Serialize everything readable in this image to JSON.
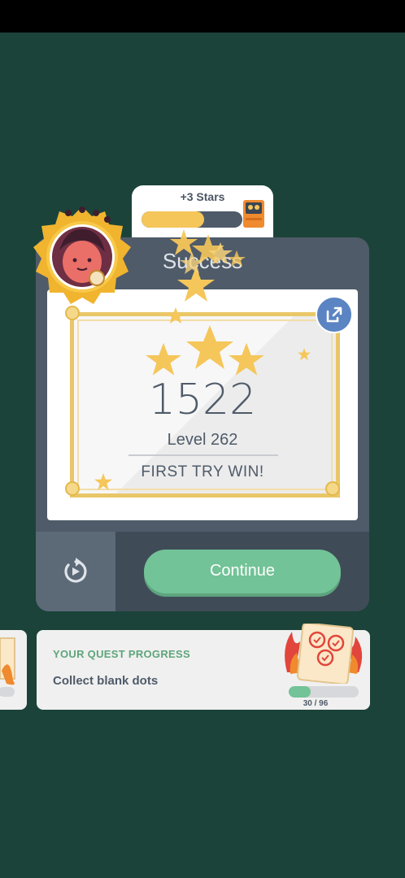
{
  "stars_panel": {
    "label": "+3 Stars",
    "progress_fraction": 0.62
  },
  "card": {
    "title": "Success"
  },
  "result": {
    "score": "1522",
    "level": "Level 262",
    "message": "FIRST TRY WIN!"
  },
  "actions": {
    "continue_label": "Continue",
    "replay_icon": "replay-icon",
    "share_icon": "share-icon"
  },
  "quest": {
    "title": "YOUR QUEST PROGRESS",
    "task": "Collect blank dots",
    "progress_text": "30 / 96",
    "progress_fraction": 0.3125
  },
  "colors": {
    "background": "#1b4339",
    "card": "#4f5b69",
    "accent_green": "#72c397",
    "gold": "#f5c65a",
    "share_blue": "#5a84c2"
  }
}
